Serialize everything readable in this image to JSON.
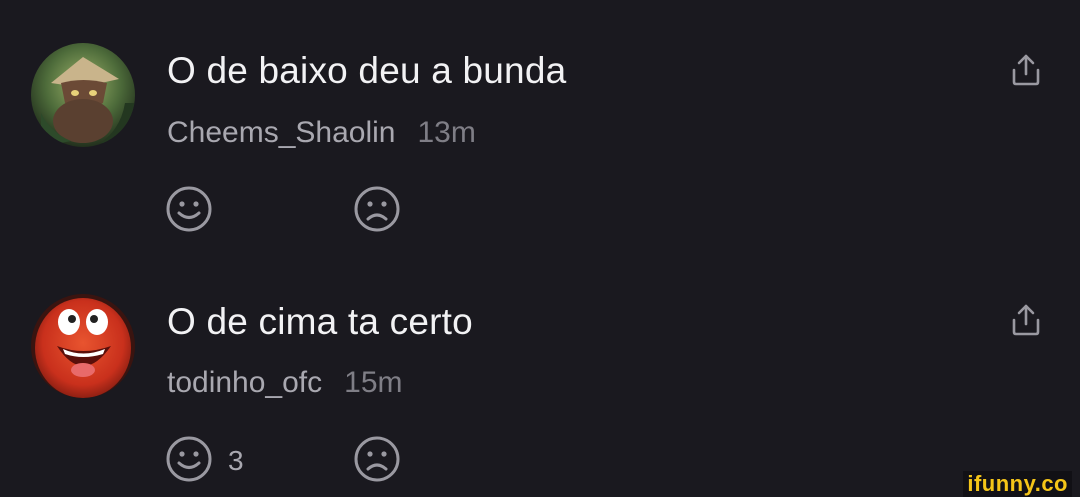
{
  "comments": [
    {
      "text": "O de baixo deu a bunda",
      "username": "Cheems_Shaolin",
      "time": "13m",
      "like_count": ""
    },
    {
      "text": "O de cima ta certo",
      "username": "todinho_ofc",
      "time": "15m",
      "like_count": "3"
    }
  ],
  "icons": {
    "share": "share-icon",
    "like": "smile-face-icon",
    "dislike": "sad-face-icon"
  },
  "colors": {
    "background": "#1a191f",
    "text": "#f2f2f4",
    "meta": "#a9a8b0",
    "icon": "#9a99a1",
    "watermark": "#f5c518"
  },
  "watermark": "ifunny.co"
}
